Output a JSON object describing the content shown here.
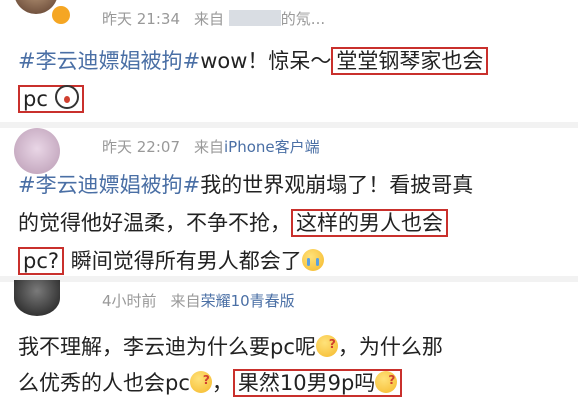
{
  "posts": [
    {
      "time": "昨天 21:34",
      "source_prefix": "来自",
      "source_suffix": "的氖...",
      "text_before_tag": "",
      "tag": "#李云迪嫖娼被拘#",
      "line1_rest": "wow！惊呆～",
      "highlight1": "堂堂钢琴家也会",
      "highlight2": "pc",
      "emoji": "shock-emoji"
    },
    {
      "time": "昨天 22:07",
      "source_prefix": "来自",
      "source": "iPhone客户端",
      "tag": "#李云迪嫖娼被拘#",
      "line1_rest": "我的世界观崩塌了！看披哥真",
      "line2_before": "的觉得他好温柔，不争不抢，",
      "highlight1": "这样的男人也会",
      "highlight2": "pc?",
      "line3_rest": "瞬间觉得所有男人都会了",
      "emoji": "cry-emoji"
    },
    {
      "time": "4小时前",
      "source_prefix": "来自",
      "source": "荣耀10青春版",
      "line1": "我不理解，李云迪为什么要pc呢",
      "line1_rest": "，为什么那",
      "line2_before": "么优秀的人也会pc",
      "highlight": "果然10男9p吗",
      "emoji": "think-emoji"
    }
  ]
}
